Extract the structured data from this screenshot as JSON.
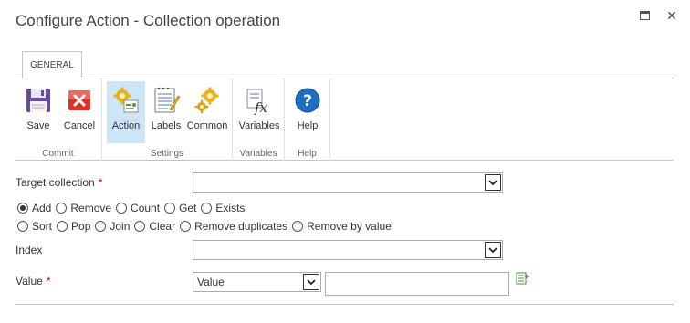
{
  "dialog": {
    "title": "Configure Action - Collection operation"
  },
  "tabs": [
    {
      "label": "GENERAL"
    }
  ],
  "ribbon": {
    "groups": [
      {
        "label": "Commit",
        "buttons": [
          {
            "label": "Save",
            "icon": "floppy-disk-icon"
          },
          {
            "label": "Cancel",
            "icon": "cancel-x-icon"
          }
        ]
      },
      {
        "label": "Settings",
        "buttons": [
          {
            "label": "Action",
            "icon": "action-gears-icon",
            "active": true
          },
          {
            "label": "Labels",
            "icon": "labels-notepad-icon"
          },
          {
            "label": "Common",
            "icon": "common-gears-icon"
          }
        ]
      },
      {
        "label": "Variables",
        "buttons": [
          {
            "label": "Variables",
            "icon": "variables-fx-icon"
          }
        ]
      },
      {
        "label": "Help",
        "buttons": [
          {
            "label": "Help",
            "icon": "help-question-icon"
          }
        ]
      }
    ]
  },
  "form": {
    "target_collection": {
      "label": "Target collection",
      "required": "*",
      "value": ""
    },
    "operations_row1": [
      {
        "label": "Add",
        "checked": true
      },
      {
        "label": "Remove"
      },
      {
        "label": "Count"
      },
      {
        "label": "Get"
      },
      {
        "label": "Exists"
      }
    ],
    "operations_row2": [
      {
        "label": "Sort"
      },
      {
        "label": "Pop"
      },
      {
        "label": "Join"
      },
      {
        "label": "Clear"
      },
      {
        "label": "Remove duplicates"
      },
      {
        "label": "Remove by value"
      }
    ],
    "index": {
      "label": "Index",
      "value": ""
    },
    "value": {
      "label": "Value",
      "required": "*",
      "type_selected": "Value",
      "input_value": ""
    }
  },
  "colors": {
    "active_button_bg": "#cde6f7",
    "required": "#cc0000",
    "help_icon": "#1f6fbf",
    "cancel_icon": "#d9332b",
    "save_icon": "#6a4a9c"
  }
}
